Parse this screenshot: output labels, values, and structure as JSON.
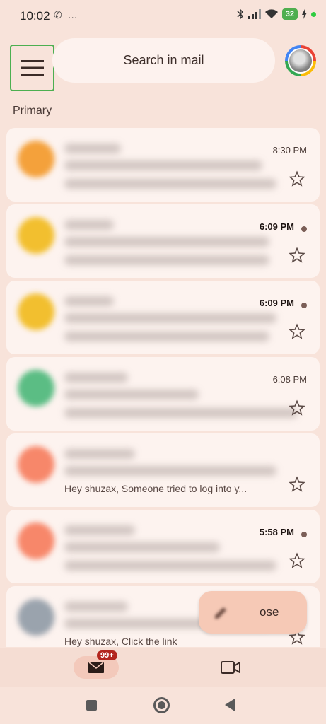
{
  "status_bar": {
    "time": "10:02",
    "left_icons": "✆ …",
    "battery": "32"
  },
  "header": {
    "search_placeholder": "Search in mail"
  },
  "section_label": "Primary",
  "emails": [
    {
      "time": "8:30 PM",
      "unread": false,
      "avatar_color": "#f4a13b",
      "preview": ""
    },
    {
      "time": "6:09 PM",
      "unread": true,
      "avatar_color": "#f2bf2f",
      "preview": ""
    },
    {
      "time": "6:09 PM",
      "unread": true,
      "avatar_color": "#f2bf2f",
      "preview": ""
    },
    {
      "time": "6:08 PM",
      "unread": false,
      "avatar_color": "#5bbd84",
      "preview": ""
    },
    {
      "time": "",
      "unread": false,
      "avatar_color": "#f7876a",
      "preview": "Hey shuzax, Someone tried to log into y..."
    },
    {
      "time": "5:58 PM",
      "unread": true,
      "avatar_color": "#f7876a",
      "preview": ""
    },
    {
      "time": "",
      "unread": false,
      "avatar_color": "#9aa3ad",
      "preview": "Hey shuzax, Click the link"
    }
  ],
  "compose": {
    "label": "ose"
  },
  "bottom_nav": {
    "mail_badge": "99+"
  },
  "colors": {
    "background": "#f8e3da",
    "card": "#fdf3ef",
    "badge": "#b3261e",
    "fab": "#f6c9b6"
  }
}
